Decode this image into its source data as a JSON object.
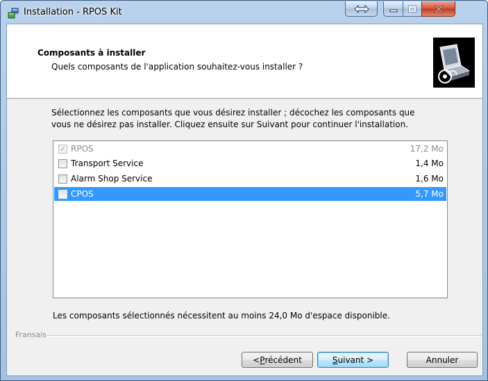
{
  "window": {
    "title": "Installation - RPOS Kit"
  },
  "header": {
    "title": "Composants à installer",
    "subtitle": "Quels composants de l'application souhaitez-vous installer ?"
  },
  "instructions": {
    "line1": "Sélectionnez les composants que vous désirez installer ; décochez les composants que",
    "line2": "vous ne désirez pas installer. Cliquez ensuite sur Suivant pour continuer l'installation."
  },
  "components": [
    {
      "name": "RPOS",
      "size": "17,2 Mo",
      "checked": true,
      "disabled": true,
      "selected": false
    },
    {
      "name": "Transport Service",
      "size": "1,4 Mo",
      "checked": false,
      "disabled": false,
      "selected": false
    },
    {
      "name": "Alarm Shop Service",
      "size": "1,6 Mo",
      "checked": false,
      "disabled": false,
      "selected": false
    },
    {
      "name": "CPOS",
      "size": "5,7 Mo",
      "checked": false,
      "disabled": false,
      "selected": true
    }
  ],
  "space_required": "Les composants sélectionnés nécessitent au moins 24,0 Mo d'espace disponible.",
  "language_label": "Fransais",
  "buttons": {
    "prev_prefix": "< ",
    "prev_hotkey": "P",
    "prev_rest": "récédent",
    "next_hotkey": "S",
    "next_rest": "uivant >",
    "cancel": "Annuler"
  },
  "colors": {
    "selection": "#3399ff",
    "title_bar": "#b9d1ea",
    "close_button": "#c23a1e"
  }
}
